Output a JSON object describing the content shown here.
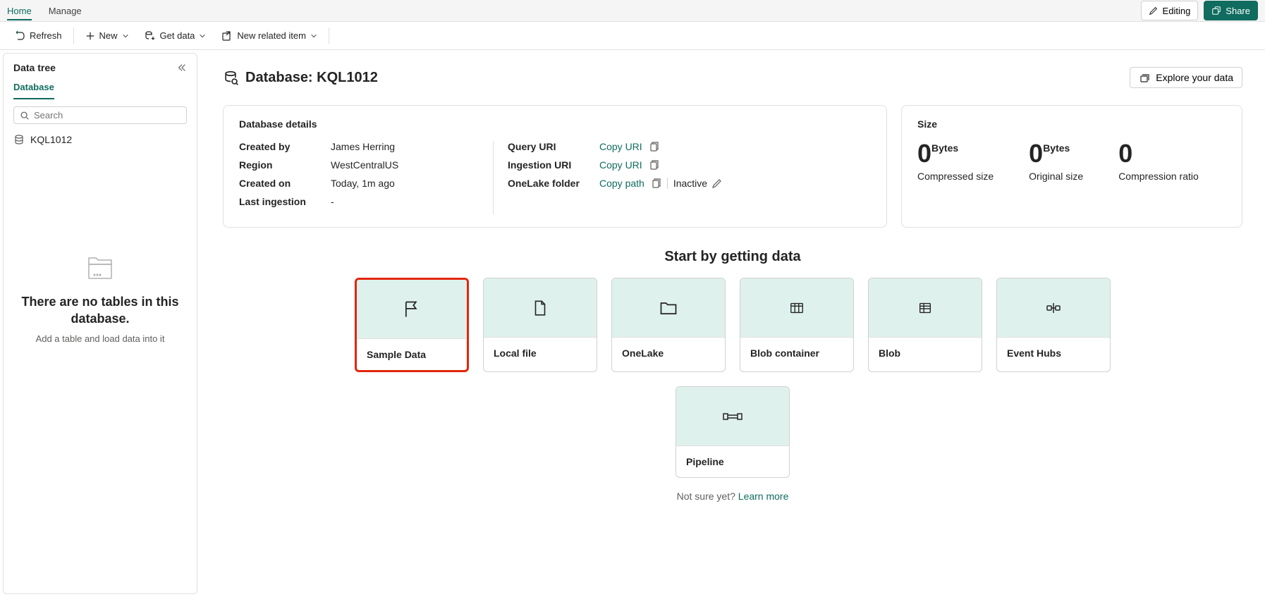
{
  "tabs": {
    "home": "Home",
    "manage": "Manage"
  },
  "actions": {
    "editing": "Editing",
    "share": "Share"
  },
  "toolbar": {
    "refresh": "Refresh",
    "new": "New",
    "getdata": "Get data",
    "newrelated": "New related item"
  },
  "sidebar": {
    "title": "Data tree",
    "tab": "Database",
    "search_placeholder": "Search",
    "db_name": "KQL1012",
    "empty_title": "There are no tables in this database.",
    "empty_sub": "Add a table and load data into it"
  },
  "page": {
    "title_prefix": "Database: ",
    "db_name": "KQL1012",
    "explore": "Explore your data"
  },
  "details": {
    "title": "Database details",
    "created_by_k": "Created by",
    "created_by_v": "James Herring",
    "region_k": "Region",
    "region_v": "WestCentralUS",
    "created_on_k": "Created on",
    "created_on_v": "Today, 1m ago",
    "last_ingestion_k": "Last ingestion",
    "last_ingestion_v": "-",
    "query_uri_k": "Query URI",
    "copy_uri": "Copy URI",
    "ingestion_uri_k": "Ingestion URI",
    "onelake_k": "OneLake folder",
    "copy_path": "Copy path",
    "inactive": "Inactive"
  },
  "size": {
    "title": "Size",
    "compressed_val": "0",
    "compressed_unit": "Bytes",
    "compressed_label": "Compressed size",
    "original_val": "0",
    "original_unit": "Bytes",
    "original_label": "Original size",
    "ratio_val": "0",
    "ratio_label": "Compression ratio"
  },
  "getdata": {
    "title": "Start by getting data",
    "tiles": {
      "sample": "Sample Data",
      "local": "Local file",
      "onelake": "OneLake",
      "blobcontainer": "Blob container",
      "blob": "Blob",
      "eventhubs": "Event Hubs",
      "pipeline": "Pipeline"
    },
    "hint_prefix": "Not sure yet? ",
    "hint_link": "Learn more"
  }
}
